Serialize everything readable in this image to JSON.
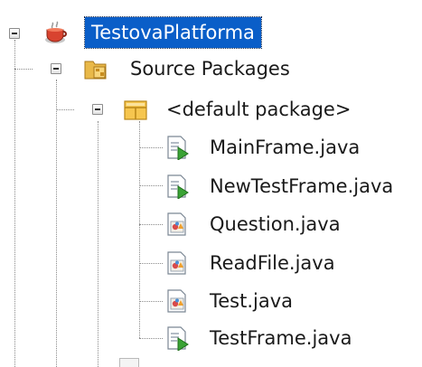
{
  "project_tree": {
    "project": {
      "label": "TestovaPlatforma",
      "icon": "java-cup-project-icon",
      "selected": true,
      "expanded": true
    },
    "source_packages": {
      "label": "Source Packages",
      "icon": "source-packages-folder-icon",
      "expanded": true
    },
    "default_package": {
      "label": "<default package>",
      "icon": "package-icon",
      "expanded": true
    },
    "files": [
      {
        "label": "MainFrame.java",
        "icon": "runnable-java-file-icon"
      },
      {
        "label": "NewTestFrame.java",
        "icon": "runnable-java-file-icon"
      },
      {
        "label": "Question.java",
        "icon": "java-class-file-icon"
      },
      {
        "label": "ReadFile.java",
        "icon": "java-class-file-icon"
      },
      {
        "label": "Test.java",
        "icon": "java-class-file-icon"
      },
      {
        "label": "TestFrame.java",
        "icon": "runnable-java-file-icon"
      }
    ]
  },
  "colors": {
    "selection": "#0a5ec8",
    "tree_lines": "#8a8a8a",
    "package_icon": "#f0b429"
  }
}
